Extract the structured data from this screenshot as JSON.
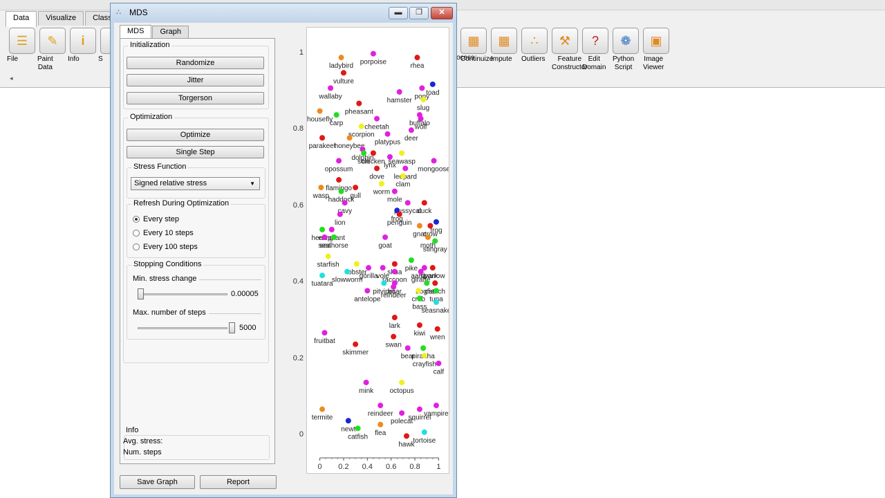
{
  "background": {
    "tabs": [
      "Data",
      "Visualize",
      "Classify"
    ],
    "left_widgets": [
      {
        "label": "File",
        "icon": "file-icon"
      },
      {
        "label": "Paint\nData",
        "icon": "paint-data-icon"
      },
      {
        "label": "Info",
        "icon": "info-icon"
      },
      {
        "label": "S",
        "icon": "widget-icon"
      }
    ],
    "right_widgets": [
      {
        "label": "ocess",
        "icon": "preprocess-icon"
      },
      {
        "label": "Continuize",
        "icon": "continuize-icon"
      },
      {
        "label": "Impute",
        "icon": "impute-icon"
      },
      {
        "label": "Outliers",
        "icon": "outliers-icon"
      },
      {
        "label": "Feature\nConstructor",
        "icon": "feature-constructor-icon"
      },
      {
        "label": "Edit\nDomain",
        "icon": "edit-domain-icon"
      },
      {
        "label": "Python\nScript",
        "icon": "python-script-icon"
      },
      {
        "label": "Image\nViewer",
        "icon": "image-viewer-icon"
      }
    ],
    "scroll_arrow": "◂"
  },
  "window": {
    "title": "MDS",
    "minimize": "▬",
    "maximize": "❐",
    "close": "✕"
  },
  "tabs": [
    "MDS",
    "Graph"
  ],
  "initialization": {
    "title": "Initialization",
    "buttons": [
      "Randomize",
      "Jitter",
      "Torgerson"
    ]
  },
  "optimization": {
    "title": "Optimization",
    "buttons": [
      "Optimize",
      "Single Step"
    ],
    "stress_function_title": "Stress Function",
    "stress_function_value": "Signed relative stress",
    "refresh_title": "Refresh During Optimization",
    "refresh_options": [
      "Every step",
      "Every 10 steps",
      "Every 100 steps"
    ],
    "refresh_selected": 0,
    "stopping_title": "Stopping Conditions",
    "min_stress_label": "Min. stress change",
    "min_stress_value": "0.00005",
    "min_stress_fraction": 0.0,
    "max_steps_label": "Max. number of steps",
    "max_steps_value": "5000",
    "max_steps_fraction": 1.0
  },
  "info": {
    "title": "Info",
    "avg_stress_label": "Avg. stress:",
    "num_steps_label": "Num. steps"
  },
  "bottom_buttons": {
    "save_graph": "Save Graph",
    "report": "Report"
  },
  "chart_data": {
    "type": "scatter",
    "xlim": [
      -0.05,
      1.05
    ],
    "ylim": [
      -0.05,
      1.05
    ],
    "xticks": [
      0,
      0.2,
      0.4,
      0.6,
      0.8,
      1
    ],
    "xtick_labels": [
      "0",
      "0.2",
      "0.4",
      "0.6",
      "0.8",
      "1"
    ],
    "yticks": [
      0,
      0.2,
      0.4,
      0.6,
      0.8,
      1
    ],
    "ytick_labels": [
      "0",
      "0.2",
      "0.4",
      "0.6",
      "0.8",
      "1"
    ],
    "colors": {
      "mammal": "#e020e0",
      "bird": "#e01818",
      "fish": "#22dd22",
      "insect": "#f08a20",
      "invertebrate": "#f0f020",
      "reptile": "#20e0e0",
      "amphibian": "#1828d0"
    },
    "points": [
      {
        "label": "ladybird",
        "x": 0.18,
        "y": 0.99,
        "class": "insect"
      },
      {
        "label": "porpoise",
        "x": 0.45,
        "y": 1.0,
        "class": "mammal"
      },
      {
        "label": "rhea",
        "x": 0.82,
        "y": 0.99,
        "class": "bird"
      },
      {
        "label": "vulture",
        "x": 0.2,
        "y": 0.95,
        "class": "bird"
      },
      {
        "label": "wallaby",
        "x": 0.09,
        "y": 0.91,
        "class": "mammal"
      },
      {
        "label": "hamster",
        "x": 0.67,
        "y": 0.9,
        "class": "mammal"
      },
      {
        "label": "pony",
        "x": 0.86,
        "y": 0.91,
        "class": "mammal"
      },
      {
        "label": "toad",
        "x": 0.95,
        "y": 0.92,
        "class": "amphibian"
      },
      {
        "label": "slug",
        "x": 0.87,
        "y": 0.88,
        "class": "invertebrate"
      },
      {
        "label": "pheasant",
        "x": 0.33,
        "y": 0.87,
        "class": "bird"
      },
      {
        "label": "housefly",
        "x": 0.0,
        "y": 0.85,
        "class": "insect"
      },
      {
        "label": "carp",
        "x": 0.14,
        "y": 0.84,
        "class": "fish"
      },
      {
        "label": "buffalo",
        "x": 0.84,
        "y": 0.84,
        "class": "mammal"
      },
      {
        "label": "wolf",
        "x": 0.85,
        "y": 0.83,
        "class": "mammal"
      },
      {
        "label": "cheetah",
        "x": 0.48,
        "y": 0.83,
        "class": "mammal"
      },
      {
        "label": "scorpion",
        "x": 0.35,
        "y": 0.81,
        "class": "invertebrate"
      },
      {
        "label": "deer",
        "x": 0.77,
        "y": 0.8,
        "class": "mammal"
      },
      {
        "label": "platypus",
        "x": 0.57,
        "y": 0.79,
        "class": "mammal"
      },
      {
        "label": "parakeet",
        "x": 0.02,
        "y": 0.78,
        "class": "bird"
      },
      {
        "label": "honeybee",
        "x": 0.25,
        "y": 0.78,
        "class": "insect"
      },
      {
        "label": "dolphin",
        "x": 0.36,
        "y": 0.75,
        "class": "mammal"
      },
      {
        "label": "sole",
        "x": 0.37,
        "y": 0.74,
        "class": "fish"
      },
      {
        "label": "chicken",
        "x": 0.45,
        "y": 0.74,
        "class": "bird"
      },
      {
        "label": "seawasp",
        "x": 0.69,
        "y": 0.74,
        "class": "invertebrate"
      },
      {
        "label": "lynx",
        "x": 0.59,
        "y": 0.73,
        "class": "mammal"
      },
      {
        "label": "opossum",
        "x": 0.16,
        "y": 0.72,
        "class": "mammal"
      },
      {
        "label": "mongoose",
        "x": 0.96,
        "y": 0.72,
        "class": "mammal"
      },
      {
        "label": "leopard",
        "x": 0.72,
        "y": 0.7,
        "class": "mammal"
      },
      {
        "label": "dove",
        "x": 0.48,
        "y": 0.7,
        "class": "bird"
      },
      {
        "label": "clam",
        "x": 0.7,
        "y": 0.68,
        "class": "invertebrate"
      },
      {
        "label": "flamingo",
        "x": 0.16,
        "y": 0.67,
        "class": "bird"
      },
      {
        "label": "wasp",
        "x": 0.01,
        "y": 0.65,
        "class": "insect"
      },
      {
        "label": "gull",
        "x": 0.3,
        "y": 0.65,
        "class": "bird"
      },
      {
        "label": "worm",
        "x": 0.52,
        "y": 0.66,
        "class": "invertebrate"
      },
      {
        "label": "haddock",
        "x": 0.18,
        "y": 0.64,
        "class": "fish"
      },
      {
        "label": "mole",
        "x": 0.63,
        "y": 0.64,
        "class": "mammal"
      },
      {
        "label": "cavy",
        "x": 0.21,
        "y": 0.61,
        "class": "mammal"
      },
      {
        "label": "pussycat",
        "x": 0.74,
        "y": 0.61,
        "class": "mammal"
      },
      {
        "label": "duck",
        "x": 0.88,
        "y": 0.61,
        "class": "bird"
      },
      {
        "label": "frog",
        "x": 0.65,
        "y": 0.59,
        "class": "amphibian"
      },
      {
        "label": "penguin",
        "x": 0.67,
        "y": 0.58,
        "class": "bird"
      },
      {
        "label": "lion",
        "x": 0.17,
        "y": 0.58,
        "class": "mammal"
      },
      {
        "label": "frog",
        "x": 0.98,
        "y": 0.56,
        "class": "amphibian"
      },
      {
        "label": "gnat",
        "x": 0.84,
        "y": 0.55,
        "class": "insect"
      },
      {
        "label": "crow",
        "x": 0.93,
        "y": 0.55,
        "class": "bird"
      },
      {
        "label": "herring",
        "x": 0.02,
        "y": 0.54,
        "class": "fish"
      },
      {
        "label": "elephant",
        "x": 0.1,
        "y": 0.54,
        "class": "mammal"
      },
      {
        "label": "seal",
        "x": 0.04,
        "y": 0.52,
        "class": "mammal"
      },
      {
        "label": "seahorse",
        "x": 0.12,
        "y": 0.52,
        "class": "fish"
      },
      {
        "label": "goat",
        "x": 0.55,
        "y": 0.52,
        "class": "mammal"
      },
      {
        "label": "moth",
        "x": 0.91,
        "y": 0.52,
        "class": "insect"
      },
      {
        "label": "stingray",
        "x": 0.97,
        "y": 0.51,
        "class": "fish"
      },
      {
        "label": "starfish",
        "x": 0.07,
        "y": 0.47,
        "class": "invertebrate"
      },
      {
        "label": "pike",
        "x": 0.77,
        "y": 0.46,
        "class": "fish"
      },
      {
        "label": "lobster",
        "x": 0.31,
        "y": 0.45,
        "class": "invertebrate"
      },
      {
        "label": "skua",
        "x": 0.63,
        "y": 0.45,
        "class": "bird"
      },
      {
        "label": "gorilla",
        "x": 0.41,
        "y": 0.44,
        "class": "mammal"
      },
      {
        "label": "vole",
        "x": 0.53,
        "y": 0.44,
        "class": "mammal"
      },
      {
        "label": "raccoon",
        "x": 0.63,
        "y": 0.43,
        "class": "mammal"
      },
      {
        "label": "aardvark",
        "x": 0.88,
        "y": 0.44,
        "class": "mammal"
      },
      {
        "label": "sparrow",
        "x": 0.95,
        "y": 0.44,
        "class": "bird"
      },
      {
        "label": "giraffe",
        "x": 0.85,
        "y": 0.43,
        "class": "mammal"
      },
      {
        "label": "slowworm",
        "x": 0.23,
        "y": 0.43,
        "class": "reptile"
      },
      {
        "label": "tuatara",
        "x": 0.02,
        "y": 0.42,
        "class": "reptile"
      },
      {
        "label": "boar",
        "x": 0.63,
        "y": 0.4,
        "class": "mammal"
      },
      {
        "label": "pitviper",
        "x": 0.54,
        "y": 0.4,
        "class": "reptile"
      },
      {
        "label": "reindeer",
        "x": 0.62,
        "y": 0.39,
        "class": "mammal"
      },
      {
        "label": "dogfish",
        "x": 0.9,
        "y": 0.4,
        "class": "fish"
      },
      {
        "label": "ostrich",
        "x": 0.97,
        "y": 0.4,
        "class": "bird"
      },
      {
        "label": "antelope",
        "x": 0.4,
        "y": 0.38,
        "class": "mammal"
      },
      {
        "label": "crab",
        "x": 0.83,
        "y": 0.38,
        "class": "invertebrate"
      },
      {
        "label": "tuna",
        "x": 0.98,
        "y": 0.38,
        "class": "fish"
      },
      {
        "label": "bass",
        "x": 0.84,
        "y": 0.36,
        "class": "fish"
      },
      {
        "label": "seasnake",
        "x": 0.98,
        "y": 0.35,
        "class": "reptile"
      },
      {
        "label": "lark",
        "x": 0.63,
        "y": 0.31,
        "class": "bird"
      },
      {
        "label": "kiwi",
        "x": 0.84,
        "y": 0.29,
        "class": "bird"
      },
      {
        "label": "wren",
        "x": 0.99,
        "y": 0.28,
        "class": "bird"
      },
      {
        "label": "fruitbat",
        "x": 0.04,
        "y": 0.27,
        "class": "mammal"
      },
      {
        "label": "swan",
        "x": 0.62,
        "y": 0.26,
        "class": "bird"
      },
      {
        "label": "skimmer",
        "x": 0.3,
        "y": 0.24,
        "class": "bird"
      },
      {
        "label": "bear",
        "x": 0.74,
        "y": 0.23,
        "class": "mammal"
      },
      {
        "label": "piranha",
        "x": 0.87,
        "y": 0.23,
        "class": "fish"
      },
      {
        "label": "crayfish",
        "x": 0.88,
        "y": 0.21,
        "class": "invertebrate"
      },
      {
        "label": "calf",
        "x": 1.0,
        "y": 0.19,
        "class": "mammal"
      },
      {
        "label": "mink",
        "x": 0.39,
        "y": 0.14,
        "class": "mammal"
      },
      {
        "label": "octopus",
        "x": 0.69,
        "y": 0.14,
        "class": "invertebrate"
      },
      {
        "label": "reindeer",
        "x": 0.51,
        "y": 0.08,
        "class": "mammal"
      },
      {
        "label": "vampire",
        "x": 0.98,
        "y": 0.08,
        "class": "mammal"
      },
      {
        "label": "squirrel",
        "x": 0.84,
        "y": 0.07,
        "class": "mammal"
      },
      {
        "label": "polecat",
        "x": 0.69,
        "y": 0.06,
        "class": "mammal"
      },
      {
        "label": "termite",
        "x": 0.02,
        "y": 0.07,
        "class": "insect"
      },
      {
        "label": "newt",
        "x": 0.24,
        "y": 0.04,
        "class": "amphibian"
      },
      {
        "label": "flea",
        "x": 0.51,
        "y": 0.03,
        "class": "insect"
      },
      {
        "label": "catfish",
        "x": 0.32,
        "y": 0.02,
        "class": "fish"
      },
      {
        "label": "hawk",
        "x": 0.73,
        "y": 0.0,
        "class": "bird"
      },
      {
        "label": "tortoise",
        "x": 0.88,
        "y": 0.01,
        "class": "reptile"
      }
    ]
  }
}
